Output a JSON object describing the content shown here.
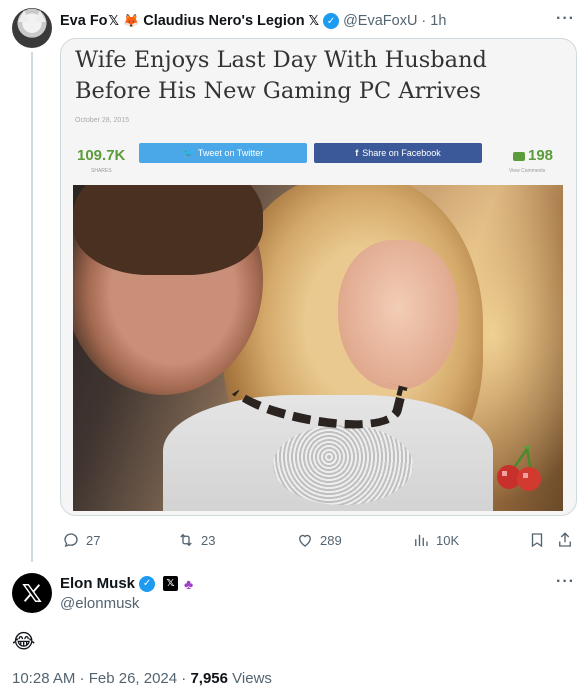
{
  "tweet": {
    "author_name": "Eva Fo",
    "author_name_x": "𝕏",
    "fox_emoji": "🦊",
    "community_name": "Claudius Nero's Legion",
    "community_x": "𝕏",
    "handle": "@EvaFoxU",
    "separator": "·",
    "time": "1h",
    "more": "···",
    "media": {
      "article_title": "Wife Enjoys Last Day With Husband Before His New Gaming PC Arrives",
      "article_date": "October 28, 2015",
      "share_count": "109.7K",
      "share_label": "SHARES",
      "tweet_button": "Tweet on Twitter",
      "facebook_button": "Share on Facebook",
      "comment_count": "198",
      "comment_label": "View Comments"
    },
    "actions": {
      "replies": "27",
      "reposts": "23",
      "likes": "289",
      "views": "10K"
    }
  },
  "reply": {
    "name": "Elon Musk",
    "x_badge": "𝕏",
    "handle": "@elonmusk",
    "more": "···",
    "content": "😂",
    "timestamp": "10:28 AM · Feb 26, 2024 · ",
    "views_count": "7,956",
    "views_label": " Views"
  },
  "colors": {
    "verified_blue": "#1d9bf0",
    "secondary_text": "#536471",
    "share_green": "#5a9b3a",
    "twitter_button": "#4aa8e8",
    "facebook_button": "#3b5998"
  }
}
